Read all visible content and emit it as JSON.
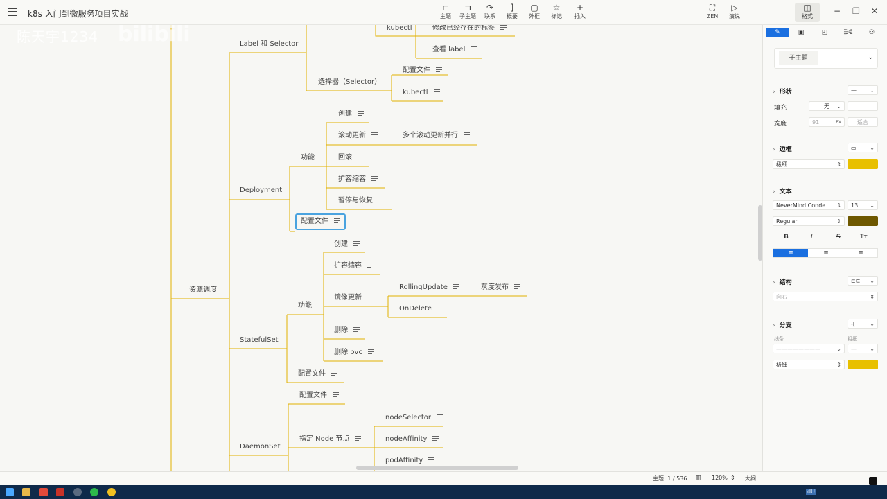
{
  "window": {
    "title": "k8s 入门到微服务项目实战",
    "watermark": "陈天宇1234",
    "watermark2": "bilibili"
  },
  "toolbar": [
    {
      "icon": "topic-icon",
      "glyph": "⊏",
      "label": "主题"
    },
    {
      "icon": "subtopic-icon",
      "glyph": "⊐",
      "label": "子主题"
    },
    {
      "icon": "relation-icon",
      "glyph": "↷",
      "label": "联系"
    },
    {
      "icon": "summary-icon",
      "glyph": "]",
      "label": "概要"
    },
    {
      "icon": "boundary-icon",
      "glyph": "▢",
      "label": "外框"
    },
    {
      "icon": "marker-icon",
      "glyph": "☆",
      "label": "标记"
    },
    {
      "icon": "insert-icon",
      "glyph": "+",
      "label": "插入"
    }
  ],
  "modes": [
    {
      "icon": "zen-icon",
      "glyph": "⛶",
      "label": "ZEN"
    },
    {
      "icon": "present-icon",
      "glyph": "▷",
      "label": "演说"
    },
    {
      "icon": "format-icon",
      "glyph": "◫",
      "label": "格式"
    }
  ],
  "window_controls": {
    "minimize": "−",
    "restore": "❐",
    "close": "✕"
  },
  "mindmap": {
    "root": "资源调度",
    "branches": {
      "label_selector": "Label 和 Selector",
      "kubectl_1": "kubectl",
      "modify_label": "修改已经存在的标签",
      "view_label": "查看 label",
      "selector": "选择器（Selector）",
      "selector_config": "配置文件",
      "selector_kubectl": "kubectl",
      "deployment": "Deployment",
      "deploy_func": "功能",
      "deploy_create": "创建",
      "deploy_rolling": "滚动更新",
      "deploy_multi_rolling": "多个滚动更新并行",
      "deploy_rollback": "回滚",
      "deploy_scale": "扩容缩容",
      "deploy_pause": "暂停与恢复",
      "deploy_config": "配置文件",
      "statefulset": "StatefulSet",
      "sts_func": "功能",
      "sts_create": "创建",
      "sts_scale": "扩容缩容",
      "sts_image_update": "镜像更新",
      "sts_rollingupdate": "RollingUpdate",
      "sts_canary": "灰度发布",
      "sts_ondelete": "OnDelete",
      "sts_delete": "删除",
      "sts_delete_pvc": "删除 pvc",
      "sts_config": "配置文件",
      "daemonset": "DaemonSet",
      "ds_config": "配置文件",
      "ds_node": "指定 Node 节点",
      "ds_nodeselector": "nodeSelector",
      "ds_nodeaffinity": "nodeAffinity",
      "ds_podaffinity": "podAffinity"
    }
  },
  "panel": {
    "tabs": [
      {
        "icon": "style-brush-icon",
        "glyph": "✎"
      },
      {
        "icon": "canvas-icon",
        "glyph": "▣"
      },
      {
        "icon": "sticker-icon",
        "glyph": "◰"
      },
      {
        "icon": "formula-icon",
        "glyph": "∋€"
      },
      {
        "icon": "outline-icon",
        "glyph": "⚇"
      }
    ],
    "style_select": "子主题",
    "shape": {
      "title": "形状",
      "fill_label": "填充",
      "fill_value": "无",
      "width_label": "宽度",
      "width_value": "91",
      "width_unit": "PX",
      "fit_label": "适合"
    },
    "border": {
      "title": "边框",
      "weight": "极细",
      "color": "#e8c000"
    },
    "text": {
      "title": "文本",
      "font": "NeverMind Conde...",
      "size": "13",
      "weight": "Regular",
      "color": "#6e5800",
      "bold": "B",
      "italic": "I",
      "strike": "S",
      "case": "Tт"
    },
    "structure": {
      "title": "结构",
      "value": "向右"
    },
    "branch": {
      "title": "分支",
      "line_label": "线条",
      "end_label": "粗细",
      "weight": "极细",
      "color": "#e8c000"
    }
  },
  "status": {
    "topic_count": "主题: 1 / 536",
    "zoom": "120%",
    "outline": "大纲"
  },
  "taskbar": {
    "input": "dU"
  },
  "colors": {
    "branch_line": "#e2b000",
    "selected_border": "#4aa3df",
    "accent": "#1a6fe0"
  }
}
